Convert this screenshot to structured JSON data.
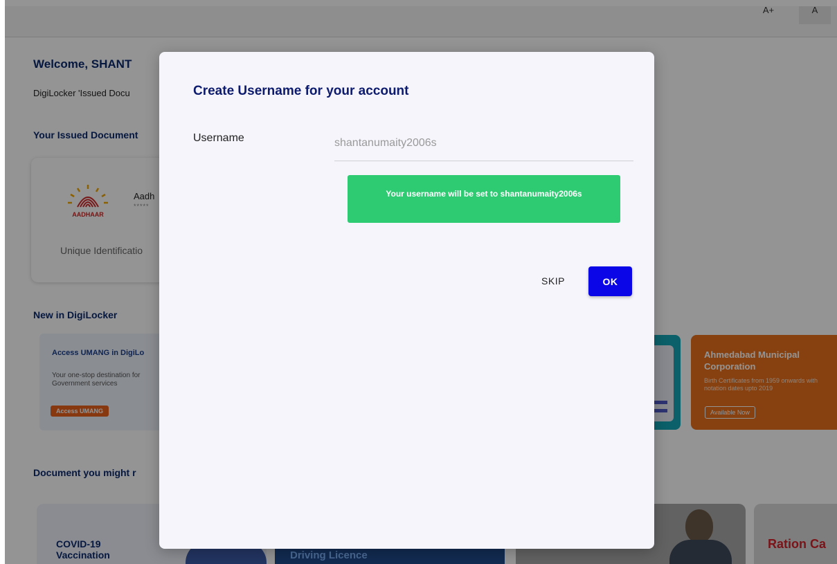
{
  "header": {
    "font_increase_label": "A+",
    "font_normal_label": "A"
  },
  "background": {
    "welcome": "Welcome, SHANT",
    "issued_desc": "DigiLocker 'Issued Docu",
    "issued_title": "Your Issued Document",
    "aadhaar": {
      "logo_text": "AADHAAR",
      "name": "Aadh",
      "masked": "*****",
      "issuer": "Unique Identificatio"
    },
    "new_title": "New in DigiLocker",
    "promo_umang": {
      "title": "Access UMANG in DigiLo",
      "desc": "Your one-stop destination for Government services",
      "button": "Access UMANG"
    },
    "promo_amc": {
      "title": "Ahmedabad Municipal Corporation",
      "desc": "Birth Certificates from 1959 onwards with notation dates upto 2019",
      "button": "Available Now"
    },
    "suggest_title": "Document you might r",
    "cards": {
      "covid": "COVID-19 Vaccination",
      "driving": "Driving Licence",
      "ration": "Ration Ca"
    }
  },
  "modal": {
    "title": "Create Username for your account",
    "username_label": "Username",
    "username_placeholder": "shantanumaity2006s",
    "info_message": "Your username will be set to shantanumaity2006s",
    "skip_label": "SKIP",
    "ok_label": "OK"
  },
  "colors": {
    "modal_title": "#0d1b6e",
    "info_green": "#2fcb73",
    "ok_blue": "#0a06e8",
    "amc_orange": "#e8711d"
  }
}
